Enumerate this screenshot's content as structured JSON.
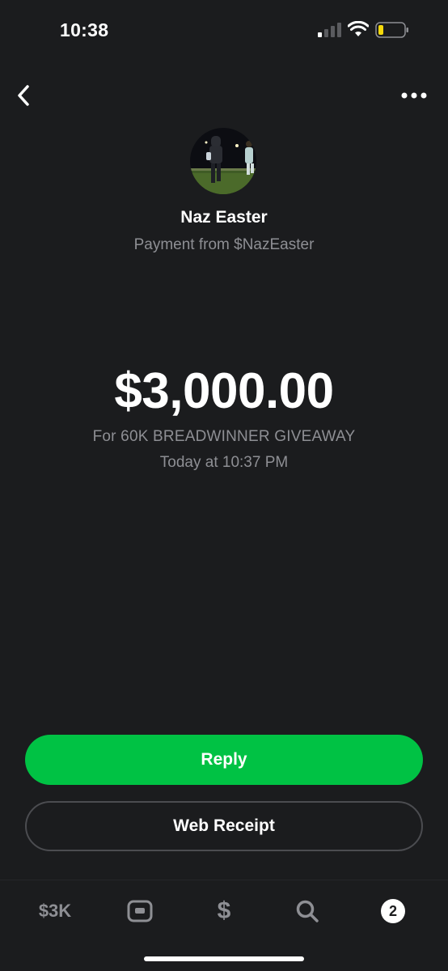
{
  "status_bar": {
    "time": "10:38"
  },
  "nav": {
    "back_icon": "chevron-left-icon",
    "more_icon": "ellipsis-icon"
  },
  "profile": {
    "name": "Naz Easter",
    "subtitle": "Payment from $NazEaster"
  },
  "payment": {
    "amount": "$3,000.00",
    "note": "For 60K BREADWINNER GIVEAWAY",
    "timestamp": "Today at 10:37 PM"
  },
  "actions": {
    "reply_label": "Reply",
    "receipt_label": "Web Receipt"
  },
  "tab_bar": {
    "balance_label": "$3K",
    "dollar_label": "$",
    "activity_badge": "2"
  },
  "colors": {
    "background": "#1b1c1e",
    "accent": "#00c244",
    "muted_text": "#8e8f94",
    "battery_level": "#f5d90a"
  }
}
